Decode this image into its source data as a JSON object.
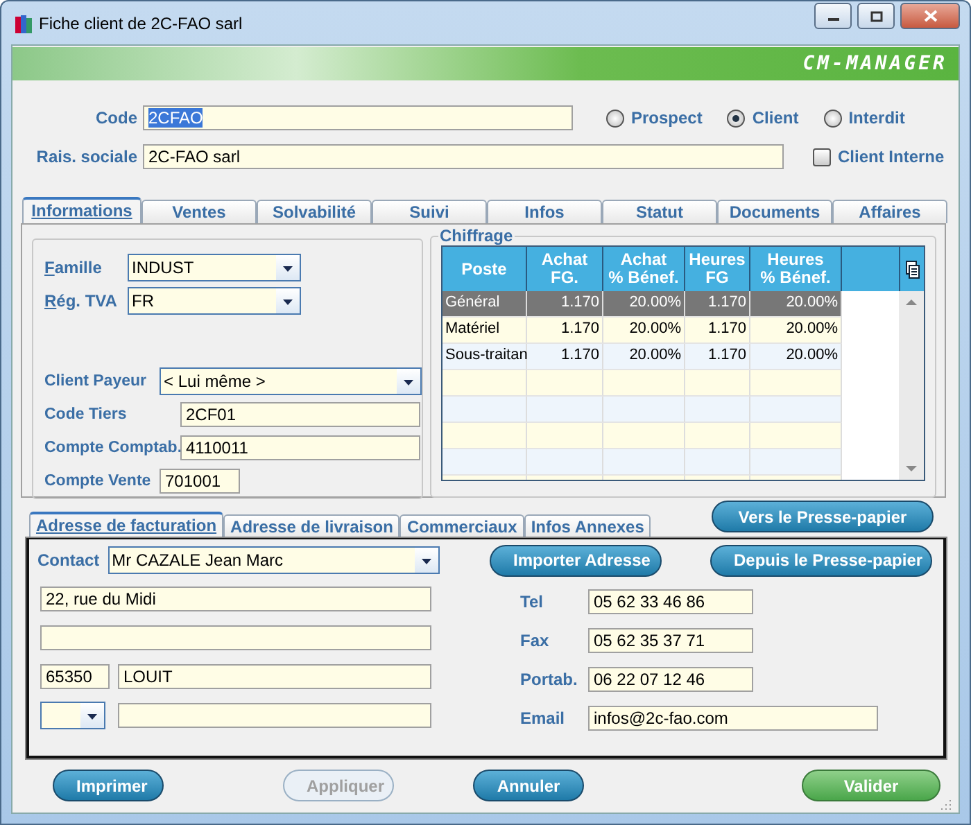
{
  "window": {
    "title": "Fiche client de 2C-FAO sarl"
  },
  "banner": {
    "brand": "CM-MANAGER"
  },
  "header": {
    "code": {
      "label": "Code",
      "value": "2CFAO",
      "selected_text": true
    },
    "raison_sociale": {
      "label": "Rais. sociale",
      "value": "2C-FAO sarl"
    },
    "status_options": [
      {
        "label": "Prospect",
        "selected": false
      },
      {
        "label": "Client",
        "selected": true
      },
      {
        "label": "Interdit",
        "selected": false
      }
    ],
    "client_interne": {
      "label": "Client Interne",
      "checked": false
    }
  },
  "tabs": [
    {
      "label": "Informations",
      "selected": true
    },
    {
      "label": "Ventes",
      "selected": false
    },
    {
      "label": "Solvabilité",
      "selected": false
    },
    {
      "label": "Suivi",
      "selected": false
    },
    {
      "label": "Infos",
      "selected": false
    },
    {
      "label": "Statut",
      "selected": false
    },
    {
      "label": "Documents",
      "selected": false
    },
    {
      "label": "Affaires",
      "selected": false
    }
  ],
  "informations": {
    "classification": [
      {
        "label": "Famille",
        "value": "INDUST",
        "accelerator": true
      },
      {
        "label": "Rég. TVA",
        "value": "FR",
        "accelerator": true
      }
    ],
    "accounts": [
      {
        "kind": "dropdown",
        "label": "Client Payeur",
        "value": "< Lui même >"
      },
      {
        "kind": "text",
        "label": "Code Tiers",
        "value": "2CF01"
      },
      {
        "kind": "text",
        "label": "Compte Comptab.",
        "value": "4110011"
      },
      {
        "kind": "short",
        "label": "Compte Vente",
        "value": "701001"
      }
    ]
  },
  "chiffrage": {
    "title": "Chiffrage",
    "columns": [
      "Poste",
      "Achat\nFG.",
      "Achat\n% Bénef.",
      "Heures\nFG",
      "Heures\n% Bénef."
    ],
    "rows": [
      {
        "cells": [
          "Général",
          "1.170",
          "20.00%",
          "1.170",
          "20.00%"
        ],
        "selected": true
      },
      {
        "cells": [
          "Matériel",
          "1.170",
          "20.00%",
          "1.170",
          "20.00%"
        ],
        "selected": false
      },
      {
        "cells": [
          "Sous-traitan",
          "1.170",
          "20.00%",
          "1.170",
          "20.00%"
        ],
        "selected": false
      }
    ]
  },
  "copy_button": "Vers le Presse-papier",
  "address_tabs": [
    {
      "label": "Adresse de facturation",
      "selected": true
    },
    {
      "label": "Adresse de livraison",
      "selected": false
    },
    {
      "label": "Commerciaux",
      "selected": false
    },
    {
      "label": "Infos Annexes",
      "selected": false
    }
  ],
  "address": {
    "contact": {
      "label": "Contact",
      "value": "Mr CAZALE Jean Marc"
    },
    "import_button": "Importer Adresse",
    "paste_button": "Depuis le Presse-papier",
    "street": "22, rue du Midi",
    "postal_code": "65350",
    "city": "LOUIT",
    "phones": [
      {
        "kind": "short",
        "label": "Tel",
        "value": "05 62 33 46 86"
      },
      {
        "kind": "short",
        "label": "Fax",
        "value": "05 62 35 37 71"
      },
      {
        "kind": "short",
        "label": "Portab.",
        "value": "06 22 07 12 46"
      },
      {
        "kind": "long",
        "label": "Email",
        "value": "infos@2c-fao.com"
      }
    ]
  },
  "buttons": [
    {
      "label": "Imprimer",
      "kind": "normal",
      "disabled": false
    },
    {
      "label": "Appliquer",
      "kind": "normal",
      "disabled": true
    },
    {
      "label": "Annuler",
      "kind": "normal",
      "disabled": false
    },
    {
      "label": "Valider",
      "kind": "confirm",
      "disabled": false
    }
  ]
}
